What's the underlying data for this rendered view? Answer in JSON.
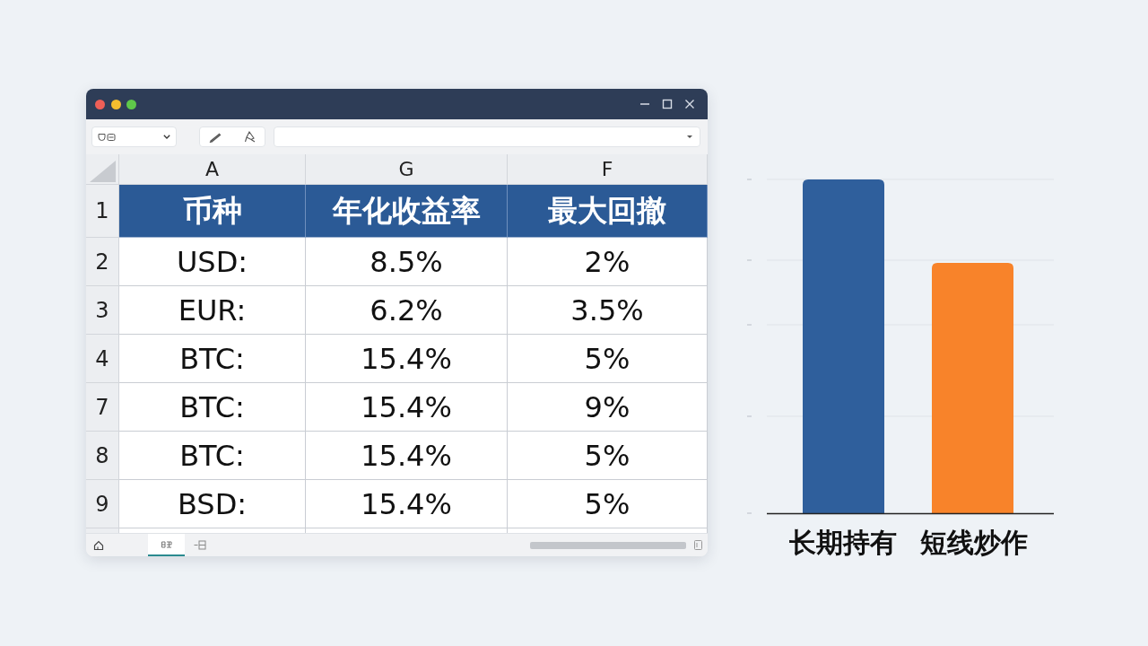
{
  "sheet": {
    "columns": [
      "A",
      "G",
      "F"
    ],
    "rows": [
      {
        "number": "1",
        "kind": "header",
        "cells": [
          "币种",
          "年化收益率",
          "最大回撤"
        ]
      },
      {
        "number": "2",
        "kind": "data",
        "cells": [
          "USD:",
          "8.5%",
          "2%"
        ]
      },
      {
        "number": "3",
        "kind": "data",
        "cells": [
          "EUR:",
          "6.2%",
          "3.5%"
        ]
      },
      {
        "number": "4",
        "kind": "data",
        "cells": [
          "BTC:",
          "15.4%",
          "5%"
        ]
      },
      {
        "number": "7",
        "kind": "data",
        "cells": [
          "BTC:",
          "15.4%",
          "9%"
        ]
      },
      {
        "number": "8",
        "kind": "data",
        "cells": [
          "BTC:",
          "15.4%",
          "5%"
        ]
      },
      {
        "number": "9",
        "kind": "data",
        "cells": [
          "BSD:",
          "15.4%",
          "5%"
        ]
      }
    ],
    "sheet_tabs": [
      {
        "selected": true
      }
    ]
  },
  "chart": {
    "bars": [
      {
        "label": "长期持有",
        "color": "#2f5f9c",
        "level": 1
      },
      {
        "label": "短线炒作",
        "color": "#f8832a",
        "level": 0.75
      }
    ]
  }
}
